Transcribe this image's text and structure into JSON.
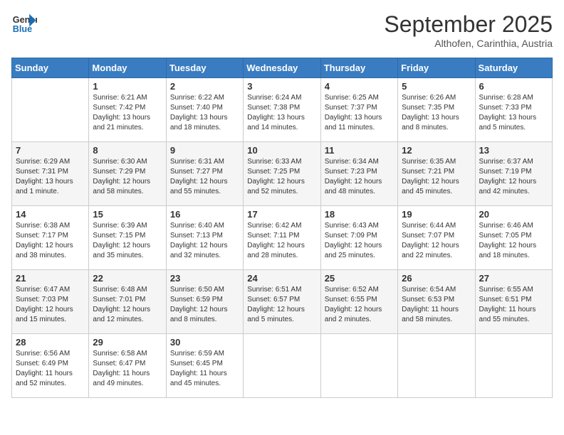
{
  "header": {
    "logo_line1": "General",
    "logo_line2": "Blue",
    "month": "September 2025",
    "location": "Althofen, Carinthia, Austria"
  },
  "days_of_week": [
    "Sunday",
    "Monday",
    "Tuesday",
    "Wednesday",
    "Thursday",
    "Friday",
    "Saturday"
  ],
  "weeks": [
    [
      {
        "day": "",
        "info": ""
      },
      {
        "day": "1",
        "info": "Sunrise: 6:21 AM\nSunset: 7:42 PM\nDaylight: 13 hours\nand 21 minutes."
      },
      {
        "day": "2",
        "info": "Sunrise: 6:22 AM\nSunset: 7:40 PM\nDaylight: 13 hours\nand 18 minutes."
      },
      {
        "day": "3",
        "info": "Sunrise: 6:24 AM\nSunset: 7:38 PM\nDaylight: 13 hours\nand 14 minutes."
      },
      {
        "day": "4",
        "info": "Sunrise: 6:25 AM\nSunset: 7:37 PM\nDaylight: 13 hours\nand 11 minutes."
      },
      {
        "day": "5",
        "info": "Sunrise: 6:26 AM\nSunset: 7:35 PM\nDaylight: 13 hours\nand 8 minutes."
      },
      {
        "day": "6",
        "info": "Sunrise: 6:28 AM\nSunset: 7:33 PM\nDaylight: 13 hours\nand 5 minutes."
      }
    ],
    [
      {
        "day": "7",
        "info": "Sunrise: 6:29 AM\nSunset: 7:31 PM\nDaylight: 13 hours\nand 1 minute."
      },
      {
        "day": "8",
        "info": "Sunrise: 6:30 AM\nSunset: 7:29 PM\nDaylight: 12 hours\nand 58 minutes."
      },
      {
        "day": "9",
        "info": "Sunrise: 6:31 AM\nSunset: 7:27 PM\nDaylight: 12 hours\nand 55 minutes."
      },
      {
        "day": "10",
        "info": "Sunrise: 6:33 AM\nSunset: 7:25 PM\nDaylight: 12 hours\nand 52 minutes."
      },
      {
        "day": "11",
        "info": "Sunrise: 6:34 AM\nSunset: 7:23 PM\nDaylight: 12 hours\nand 48 minutes."
      },
      {
        "day": "12",
        "info": "Sunrise: 6:35 AM\nSunset: 7:21 PM\nDaylight: 12 hours\nand 45 minutes."
      },
      {
        "day": "13",
        "info": "Sunrise: 6:37 AM\nSunset: 7:19 PM\nDaylight: 12 hours\nand 42 minutes."
      }
    ],
    [
      {
        "day": "14",
        "info": "Sunrise: 6:38 AM\nSunset: 7:17 PM\nDaylight: 12 hours\nand 38 minutes."
      },
      {
        "day": "15",
        "info": "Sunrise: 6:39 AM\nSunset: 7:15 PM\nDaylight: 12 hours\nand 35 minutes."
      },
      {
        "day": "16",
        "info": "Sunrise: 6:40 AM\nSunset: 7:13 PM\nDaylight: 12 hours\nand 32 minutes."
      },
      {
        "day": "17",
        "info": "Sunrise: 6:42 AM\nSunset: 7:11 PM\nDaylight: 12 hours\nand 28 minutes."
      },
      {
        "day": "18",
        "info": "Sunrise: 6:43 AM\nSunset: 7:09 PM\nDaylight: 12 hours\nand 25 minutes."
      },
      {
        "day": "19",
        "info": "Sunrise: 6:44 AM\nSunset: 7:07 PM\nDaylight: 12 hours\nand 22 minutes."
      },
      {
        "day": "20",
        "info": "Sunrise: 6:46 AM\nSunset: 7:05 PM\nDaylight: 12 hours\nand 18 minutes."
      }
    ],
    [
      {
        "day": "21",
        "info": "Sunrise: 6:47 AM\nSunset: 7:03 PM\nDaylight: 12 hours\nand 15 minutes."
      },
      {
        "day": "22",
        "info": "Sunrise: 6:48 AM\nSunset: 7:01 PM\nDaylight: 12 hours\nand 12 minutes."
      },
      {
        "day": "23",
        "info": "Sunrise: 6:50 AM\nSunset: 6:59 PM\nDaylight: 12 hours\nand 8 minutes."
      },
      {
        "day": "24",
        "info": "Sunrise: 6:51 AM\nSunset: 6:57 PM\nDaylight: 12 hours\nand 5 minutes."
      },
      {
        "day": "25",
        "info": "Sunrise: 6:52 AM\nSunset: 6:55 PM\nDaylight: 12 hours\nand 2 minutes."
      },
      {
        "day": "26",
        "info": "Sunrise: 6:54 AM\nSunset: 6:53 PM\nDaylight: 11 hours\nand 58 minutes."
      },
      {
        "day": "27",
        "info": "Sunrise: 6:55 AM\nSunset: 6:51 PM\nDaylight: 11 hours\nand 55 minutes."
      }
    ],
    [
      {
        "day": "28",
        "info": "Sunrise: 6:56 AM\nSunset: 6:49 PM\nDaylight: 11 hours\nand 52 minutes."
      },
      {
        "day": "29",
        "info": "Sunrise: 6:58 AM\nSunset: 6:47 PM\nDaylight: 11 hours\nand 49 minutes."
      },
      {
        "day": "30",
        "info": "Sunrise: 6:59 AM\nSunset: 6:45 PM\nDaylight: 11 hours\nand 45 minutes."
      },
      {
        "day": "",
        "info": ""
      },
      {
        "day": "",
        "info": ""
      },
      {
        "day": "",
        "info": ""
      },
      {
        "day": "",
        "info": ""
      }
    ]
  ]
}
